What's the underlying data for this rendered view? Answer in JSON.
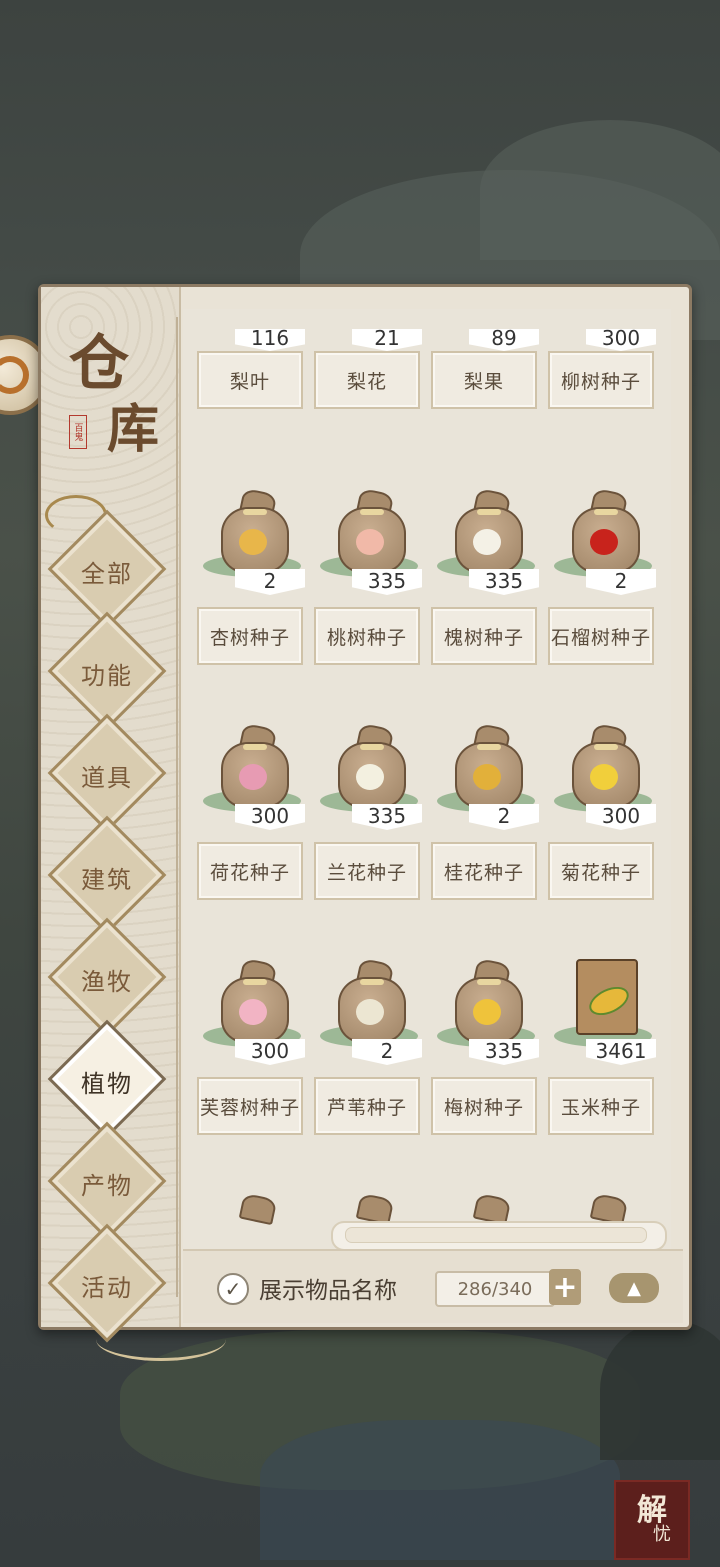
{
  "colors": {
    "accent": "#a7956f",
    "panel": "#e9e3d6",
    "text": "#5a4c3c",
    "seal": "#b33a2e"
  },
  "header": {
    "title_char1": "仓",
    "title_char2": "库",
    "seal_text": "百鬼"
  },
  "sidebar": {
    "items": [
      {
        "label": "全部",
        "active": false
      },
      {
        "label": "功能",
        "active": false
      },
      {
        "label": "道具",
        "active": false
      },
      {
        "label": "建筑",
        "active": false
      },
      {
        "label": "渔牧",
        "active": false
      },
      {
        "label": "植物",
        "active": true
      },
      {
        "label": "产物",
        "active": false
      },
      {
        "label": "活动",
        "active": false
      }
    ]
  },
  "grid": {
    "top_row": [
      {
        "count": "116",
        "name": "梨叶"
      },
      {
        "count": "21",
        "name": "梨花"
      },
      {
        "count": "89",
        "name": "梨果"
      },
      {
        "count": "300",
        "name": "柳树种子"
      }
    ],
    "rows": [
      [
        {
          "count": "2",
          "name": "杏树种子",
          "icon": "apricot-seed-bag-icon",
          "seed_color": "#e8b64a"
        },
        {
          "count": "335",
          "name": "桃树种子",
          "icon": "peach-seed-bag-icon",
          "seed_color": "#f1b9a8"
        },
        {
          "count": "335",
          "name": "槐树种子",
          "icon": "locust-seed-bag-icon",
          "seed_color": "#f4f1e6"
        },
        {
          "count": "2",
          "name": "石榴树种子",
          "icon": "pomegranate-seed-bag-icon",
          "seed_color": "#c8231c"
        }
      ],
      [
        {
          "count": "300",
          "name": "荷花种子",
          "icon": "lotus-seed-bag-icon",
          "seed_color": "#e79bb3"
        },
        {
          "count": "335",
          "name": "兰花种子",
          "icon": "orchid-seed-bag-icon",
          "seed_color": "#f3f0e0"
        },
        {
          "count": "2",
          "name": "桂花种子",
          "icon": "osmanthus-seed-bag-icon",
          "seed_color": "#e2b03a"
        },
        {
          "count": "300",
          "name": "菊花种子",
          "icon": "chrysanthemum-seed-bag-icon",
          "seed_color": "#f1cf3b"
        }
      ],
      [
        {
          "count": "300",
          "name": "芙蓉树种子",
          "icon": "hibiscus-seed-bag-icon",
          "seed_color": "#f2b4c4"
        },
        {
          "count": "2",
          "name": "芦苇种子",
          "icon": "reed-seed-bag-icon",
          "seed_color": "#ece6d2"
        },
        {
          "count": "335",
          "name": "梅树种子",
          "icon": "plum-seed-bag-icon",
          "seed_color": "#efc33b"
        },
        {
          "count": "3461",
          "name": "玉米种子",
          "icon": "corn-seed-box-icon",
          "seed_color": "#e6b83a"
        }
      ]
    ]
  },
  "footer": {
    "show_names_label": "展示物品名称",
    "show_names_checked": true,
    "capacity": "286/340",
    "plus_icon": "plus-icon",
    "collapse_icon": "up-arrow-icon"
  },
  "corner_badge": {
    "char1": "解",
    "char2": "忧"
  }
}
